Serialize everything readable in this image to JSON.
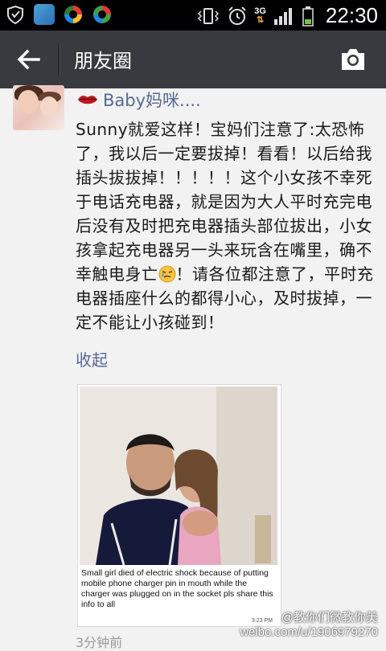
{
  "status_bar": {
    "time": "22:30",
    "network": "3G",
    "icons": [
      "shield-icon",
      "app-icon-blue",
      "app-icon-colorful-1",
      "app-icon-colorful-2",
      "vibrate-icon",
      "alarm-icon",
      "signal-icon",
      "battery-icon"
    ]
  },
  "app_bar": {
    "title": "朋友圈",
    "back_icon": "arrow-back-icon",
    "camera_icon": "camera-icon",
    "background": "#393a3f"
  },
  "post": {
    "username": "Baby妈咪....",
    "text_before_emoji": "Sunny就爱这样！宝妈们注意了:太恐怖了，我以后一定要拔掉！看看！以后给我插头拔拔掉！！！！！这个小女孩不幸死于电话充电器，就是因为大人平时充完电后没有及时把充电器插头部位拔出，小女孩拿起充电器另一头来玩含在嘴里，确不幸触电身亡",
    "text_after_emoji": "！请各位都注意了，平时充电器插座什么的都得小心，及时拔掉，一定不能让小孩碰到！",
    "collapse_label": "收起",
    "time_ago": "3分钟前",
    "image": {
      "caption": "Small girl died of electric shock because of putting mobile phone charger pin in mouth while the charger was plugged on in the socket pls share this info to all",
      "timestamp": "3:23 PM"
    }
  },
  "watermark": {
    "line1": "@教你们微教你美",
    "line2": "weibo.com/u/1906979270"
  },
  "colors": {
    "link": "#576b95",
    "background": "#f2f2f2"
  }
}
